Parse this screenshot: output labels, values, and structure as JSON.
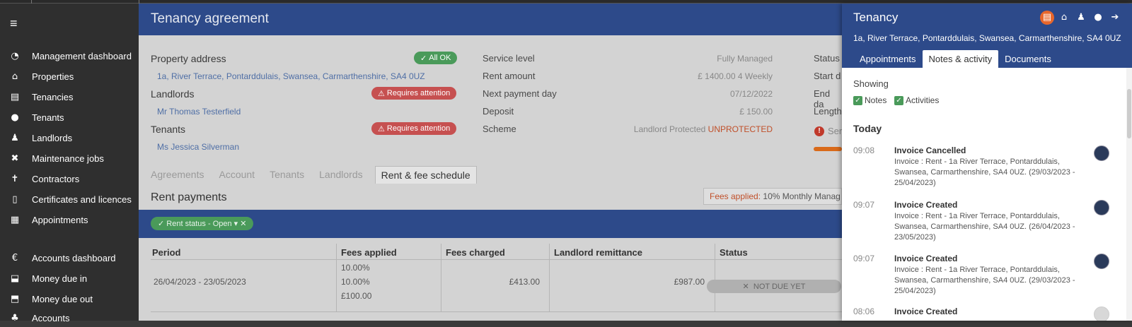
{
  "sidebar": {
    "menu_icon": "hamburger-icon",
    "items": [
      {
        "label": "Management dashboard",
        "icon": "dashboard-icon"
      },
      {
        "label": "Properties",
        "icon": "home-icon"
      },
      {
        "label": "Tenancies",
        "icon": "tenancies-icon"
      },
      {
        "label": "Tenants",
        "icon": "person-icon"
      },
      {
        "label": "Landlords",
        "icon": "landlord-icon"
      },
      {
        "label": "Maintenance jobs",
        "icon": "tools-icon"
      },
      {
        "label": "Contractors",
        "icon": "contractor-icon"
      },
      {
        "label": "Certificates and licences",
        "icon": "document-icon"
      },
      {
        "label": "Appointments",
        "icon": "calendar-icon"
      },
      {
        "label": "Accounts dashboard",
        "icon": "currency-icon"
      },
      {
        "label": "Money due in",
        "icon": "inbox-icon"
      },
      {
        "label": "Money due out",
        "icon": "outbox-icon"
      },
      {
        "label": "Accounts",
        "icon": "people-icon"
      }
    ]
  },
  "main": {
    "title": "Tenancy agreement",
    "property_address_label": "Property address",
    "property_address_status": "All OK",
    "property_address": "1a, River Terrace, Pontarddulais, Swansea, Carmarthenshire, SA4 0UZ",
    "landlords_label": "Landlords",
    "landlords_status": "Requires attention",
    "landlord_name": "Mr Thomas Testerfield",
    "tenants_label": "Tenants",
    "tenants_status": "Requires attention",
    "tenant_name": "Ms Jessica Silverman",
    "details": [
      {
        "label": "Service level",
        "value": "Fully Managed"
      },
      {
        "label": "Rent amount",
        "value": "£ 1400.00 4 Weekly"
      },
      {
        "label": "Next payment day",
        "value": "07/12/2022"
      },
      {
        "label": "Deposit",
        "value": "£ 150.00"
      }
    ],
    "scheme_label": "Scheme",
    "scheme_value": "Landlord Protected",
    "scheme_status": "UNPROTECTED",
    "right_labels": [
      "Status",
      "Start d",
      "End da",
      "Length",
      "Ser"
    ],
    "tabs": [
      {
        "label": "Agreements",
        "active": false
      },
      {
        "label": "Account",
        "active": false
      },
      {
        "label": "Tenants",
        "active": false
      },
      {
        "label": "Landlords",
        "active": false
      },
      {
        "label": "Rent & fee schedule",
        "active": true
      }
    ],
    "section_title": "Rent payments",
    "fees_applied_label": "Fees applied:",
    "fees_applied_value": "10% Monthly Manag",
    "filter_chip": "Rent status - Open",
    "table": {
      "headers": [
        "Period",
        "Fees applied",
        "Fees charged",
        "Landlord remittance",
        "Status"
      ],
      "rows": [
        {
          "period": "26/04/2023 - 23/05/2023",
          "fees": [
            "10.00%",
            "10.00%",
            "£100.00"
          ],
          "fees_charged": "£413.00",
          "remittance": "£987.00",
          "status": "NOT DUE YET"
        }
      ]
    }
  },
  "panel": {
    "title": "Tenancy",
    "address": "1a, River Terrace, Pontarddulais, Swansea, Carmarthenshire, SA4 0UZ",
    "header_icons": [
      "tenancy-icon",
      "home-icon",
      "landlord-icon",
      "person-icon",
      "arrow-right-icon"
    ],
    "tabs": [
      {
        "label": "Appointments",
        "active": false
      },
      {
        "label": "Notes & activity",
        "active": true
      },
      {
        "label": "Documents",
        "active": false
      }
    ],
    "showing_label": "Showing",
    "filters": [
      {
        "label": "Notes",
        "checked": true
      },
      {
        "label": "Activities",
        "checked": true
      }
    ],
    "day_label": "Today",
    "activities": [
      {
        "time": "09:08",
        "title": "Invoice Cancelled",
        "desc": "Invoice : Rent - 1a River Terrace, Pontarddulais, Swansea, Carmarthenshire, SA4 0UZ. (29/03/2023 - 25/04/2023)"
      },
      {
        "time": "09:07",
        "title": "Invoice Created",
        "desc": "Invoice : Rent - 1a River Terrace, Pontarddulais, Swansea, Carmarthenshire, SA4 0UZ. (26/04/2023 - 23/05/2023)"
      },
      {
        "time": "09:07",
        "title": "Invoice Created",
        "desc": "Invoice : Rent - 1a River Terrace, Pontarddulais, Swansea, Carmarthenshire, SA4 0UZ. (29/03/2023 - 25/04/2023)"
      },
      {
        "time": "08:06",
        "title": "Invoice Created",
        "desc": ""
      }
    ]
  }
}
